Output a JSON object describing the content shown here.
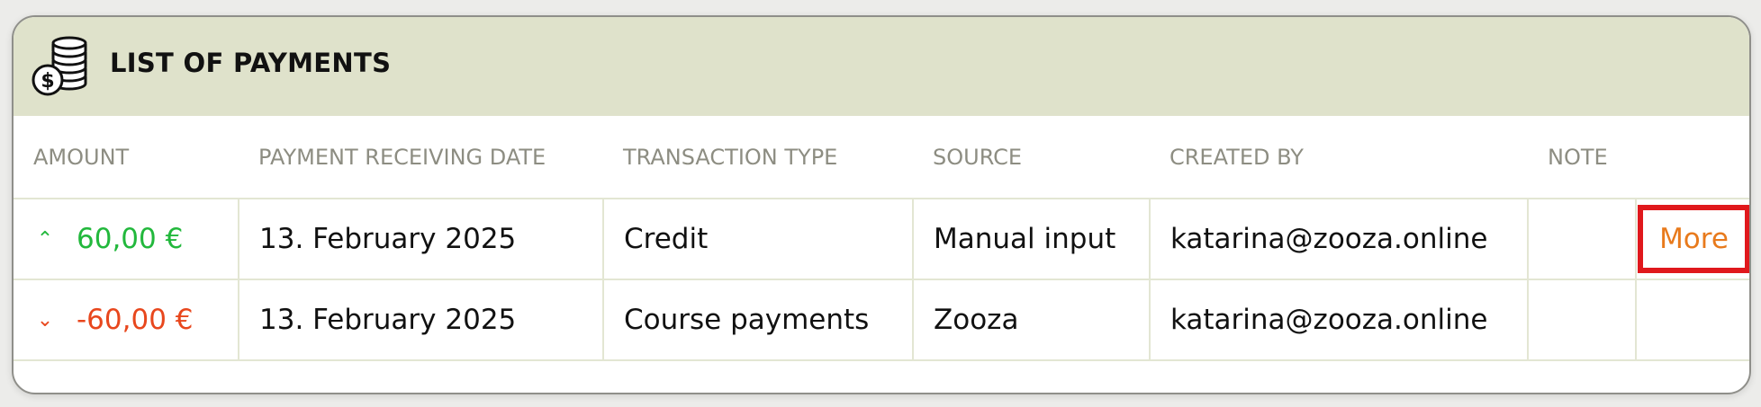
{
  "header": {
    "title": "LIST OF PAYMENTS",
    "icon": "coins-icon"
  },
  "table": {
    "columns": [
      "AMOUNT",
      "PAYMENT RECEIVING DATE",
      "TRANSACTION TYPE",
      "SOURCE",
      "CREATED BY",
      "NOTE"
    ],
    "rows": [
      {
        "direction": "up",
        "direction_icon": "chevron-up-icon",
        "amount": "60,00 €",
        "date": "13. February 2025",
        "type": "Credit",
        "source": "Manual input",
        "created_by": "katarina@zooza.online",
        "note": "",
        "action": "More"
      },
      {
        "direction": "down",
        "direction_icon": "chevron-down-icon",
        "amount": "-60,00 €",
        "date": "13. February 2025",
        "type": "Course payments",
        "source": "Zooza",
        "created_by": "katarina@zooza.online",
        "note": "",
        "action": ""
      }
    ]
  },
  "colors": {
    "header_bg": "#dfe2cb",
    "positive": "#22b83c",
    "negative": "#e8471d",
    "link": "#e87a1c",
    "highlight": "#e0181c"
  }
}
